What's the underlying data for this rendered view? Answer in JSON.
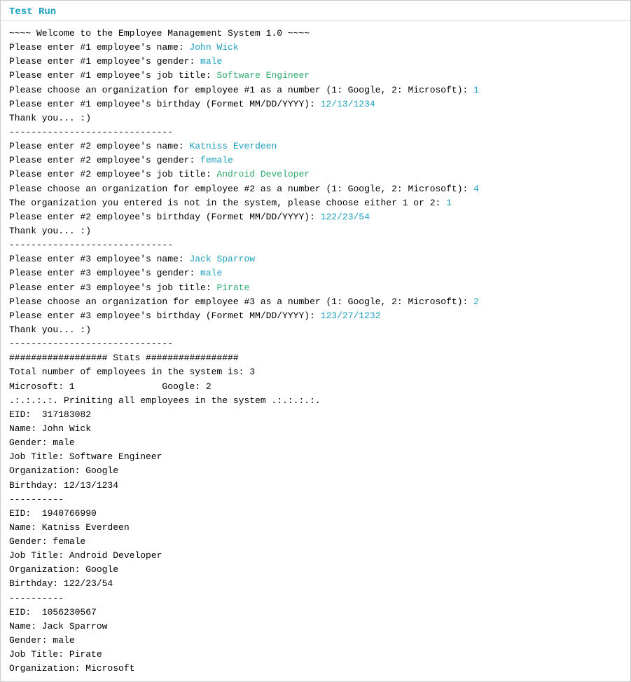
{
  "window": {
    "title": "Test Run"
  },
  "output": {
    "lines": [
      {
        "type": "normal",
        "text": "~~~~ Welcome to the Employee Management System 1.0 ~~~~"
      },
      {
        "type": "mixed",
        "prefix": "Please enter #1 employee's name: ",
        "value": "John Wick",
        "valueColor": "teal"
      },
      {
        "type": "mixed",
        "prefix": "Please enter #1 employee's gender: ",
        "value": "male",
        "valueColor": "teal"
      },
      {
        "type": "mixed",
        "prefix": "Please enter #1 employee's job title: ",
        "value": "Software Engineer",
        "valueColor": "green"
      },
      {
        "type": "mixed",
        "prefix": "Please choose an organization for employee #1 as a number (1: Google, 2: Microsoft): ",
        "value": "1",
        "valueColor": "teal"
      },
      {
        "type": "mixed",
        "prefix": "Please enter #1 employee's birthday (Formet MM/DD/YYYY): ",
        "value": "12/13/1234",
        "valueColor": "teal"
      },
      {
        "type": "normal",
        "text": "Thank you... :)"
      },
      {
        "type": "separator",
        "text": "------------------------------"
      },
      {
        "type": "mixed",
        "prefix": "Please enter #2 employee's name: ",
        "value": "Katniss Everdeen",
        "valueColor": "teal"
      },
      {
        "type": "mixed",
        "prefix": "Please enter #2 employee's gender: ",
        "value": "female",
        "valueColor": "teal"
      },
      {
        "type": "mixed",
        "prefix": "Please enter #2 employee's job title: ",
        "value": "Android Developer",
        "valueColor": "green"
      },
      {
        "type": "mixed",
        "prefix": "Please choose an organization for employee #2 as a number (1: Google, 2: Microsoft): ",
        "value": "4",
        "valueColor": "teal"
      },
      {
        "type": "mixed",
        "prefix": "The organization you entered is not in the system, please choose either 1 or 2: ",
        "value": "1",
        "valueColor": "teal"
      },
      {
        "type": "mixed",
        "prefix": "Please enter #2 employee's birthday (Formet MM/DD/YYYY): ",
        "value": "122/23/54",
        "valueColor": "teal"
      },
      {
        "type": "normal",
        "text": "Thank you... :)"
      },
      {
        "type": "separator",
        "text": "------------------------------"
      },
      {
        "type": "mixed",
        "prefix": "Please enter #3 employee's name: ",
        "value": "Jack Sparrow",
        "valueColor": "teal"
      },
      {
        "type": "mixed",
        "prefix": "Please enter #3 employee's gender: ",
        "value": "male",
        "valueColor": "teal"
      },
      {
        "type": "mixed",
        "prefix": "Please enter #3 employee's job title: ",
        "value": "Pirate",
        "valueColor": "green"
      },
      {
        "type": "mixed",
        "prefix": "Please choose an organization for employee #3 as a number (1: Google, 2: Microsoft): ",
        "value": "2",
        "valueColor": "teal"
      },
      {
        "type": "mixed",
        "prefix": "Please enter #3 employee's birthday (Formet MM/DD/YYYY): ",
        "value": "123/27/1232",
        "valueColor": "teal"
      },
      {
        "type": "normal",
        "text": "Thank you... :)"
      },
      {
        "type": "separator",
        "text": "------------------------------"
      },
      {
        "type": "normal",
        "text": "################## Stats #################"
      },
      {
        "type": "normal",
        "text": "Total number of employees in the system is: 3"
      },
      {
        "type": "normal",
        "text": "Microsoft: 1                Google: 2"
      },
      {
        "type": "normal",
        "text": ".:.:.:.:. Priniting all employees in the system .:.:.:.:."
      },
      {
        "type": "normal",
        "text": "EID:  317183082"
      },
      {
        "type": "normal",
        "text": "Name: John Wick"
      },
      {
        "type": "normal",
        "text": "Gender: male"
      },
      {
        "type": "normal",
        "text": "Job Title: Software Engineer"
      },
      {
        "type": "normal",
        "text": "Organization: Google"
      },
      {
        "type": "normal",
        "text": "Birthday: 12/13/1234"
      },
      {
        "type": "separator",
        "text": "----------"
      },
      {
        "type": "normal",
        "text": "EID:  1940766990"
      },
      {
        "type": "normal",
        "text": "Name: Katniss Everdeen"
      },
      {
        "type": "normal",
        "text": "Gender: female"
      },
      {
        "type": "normal",
        "text": "Job Title: Android Developer"
      },
      {
        "type": "normal",
        "text": "Organization: Google"
      },
      {
        "type": "normal",
        "text": "Birthday: 122/23/54"
      },
      {
        "type": "separator",
        "text": "----------"
      },
      {
        "type": "normal",
        "text": "EID:  1056230567"
      },
      {
        "type": "normal",
        "text": "Name: Jack Sparrow"
      },
      {
        "type": "normal",
        "text": "Gender: male"
      },
      {
        "type": "normal",
        "text": "Job Title: Pirate"
      },
      {
        "type": "normal",
        "text": "Organization: Microsoft"
      }
    ]
  }
}
